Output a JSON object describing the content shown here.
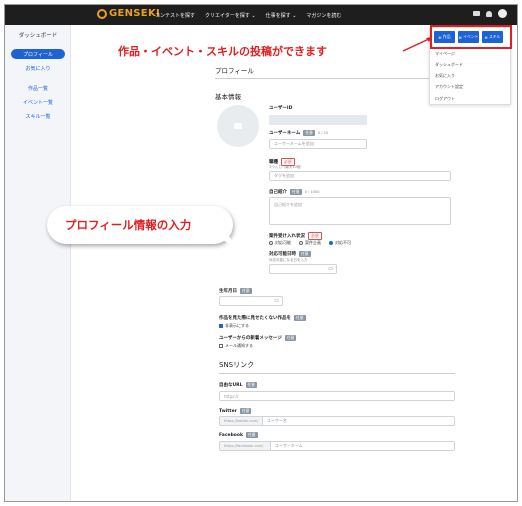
{
  "nav": {
    "logo": "GENSEKI",
    "links": [
      "コンテストを探す",
      "クリエイターを探す ⌄",
      "仕事を探す ⌄",
      "マガジンを読む"
    ]
  },
  "sidebar": {
    "title": "ダッシュボード",
    "items": [
      {
        "label": "プロフィール",
        "active": true
      },
      {
        "label": "お気に入り",
        "active": false
      },
      {
        "label": "作品一覧",
        "active": false
      },
      {
        "label": "イベント一覧",
        "active": false
      },
      {
        "label": "スキル一覧",
        "active": false
      }
    ]
  },
  "dropdown": {
    "buttons": [
      "作品",
      "イベント",
      "スキル"
    ],
    "items": [
      "マイページ",
      "ダッシュボード",
      "お気に入り",
      "アカウント設定",
      "ログアウト"
    ]
  },
  "annotations": {
    "top": "作品・イベント・スキルの投稿ができます",
    "bubble": "プロフィール情報の入力"
  },
  "profile": {
    "heading": "プロフィール",
    "basic_heading": "基本情報",
    "user_id_label": "ユーザーID",
    "username_label": "ユーザーネーム",
    "username_badge": "任意",
    "username_counter": "0 / 20",
    "username_placeholder": "ユーザーネームを追加",
    "occupation_label": "職種",
    "occupation_badge": "必須",
    "occupation_hint": "3つ入力（最大10個）",
    "occupation_placeholder": "タグを追加",
    "intro_label": "自己紹介",
    "intro_badge": "任意",
    "intro_counter": "0 / 1000",
    "intro_placeholder": "自己紹介を追加",
    "work_status_label": "案件受け入れ状況",
    "work_status_badge": "必須",
    "work_status_options": [
      "対応可能",
      "案件企画",
      "対応不可"
    ],
    "available_date_label": "対応可能日時",
    "available_date_badge": "任意",
    "available_date_hint": "対応可能になる日を入力",
    "birthday_label": "生年月日",
    "birthday_badge": "任意",
    "hide_works_label": "作品を見た際に見せたくない作品を",
    "hide_works_badge": "任意",
    "hide_works_option": "非表示にする",
    "message_label": "ユーザーからの新着メッセージ",
    "message_badge": "任意",
    "message_option": "メール通知する"
  },
  "sns": {
    "heading": "SNSリンク",
    "website_label": "自由なURL",
    "website_badge": "任意",
    "website_placeholder": "https://",
    "twitter_label": "Twitter",
    "twitter_badge": "任意",
    "twitter_prefix": "https://twitter.com/",
    "twitter_placeholder": "ユーザー名",
    "facebook_label": "Facebook",
    "facebook_badge": "任意",
    "facebook_prefix": "https://facebook.com/",
    "facebook_placeholder": "ユーザーネーム"
  },
  "colors": {
    "accent": "#1e63d6",
    "annotation": "#e02020",
    "nav_bg": "#1e1e1e",
    "logo": "#e8a025"
  }
}
